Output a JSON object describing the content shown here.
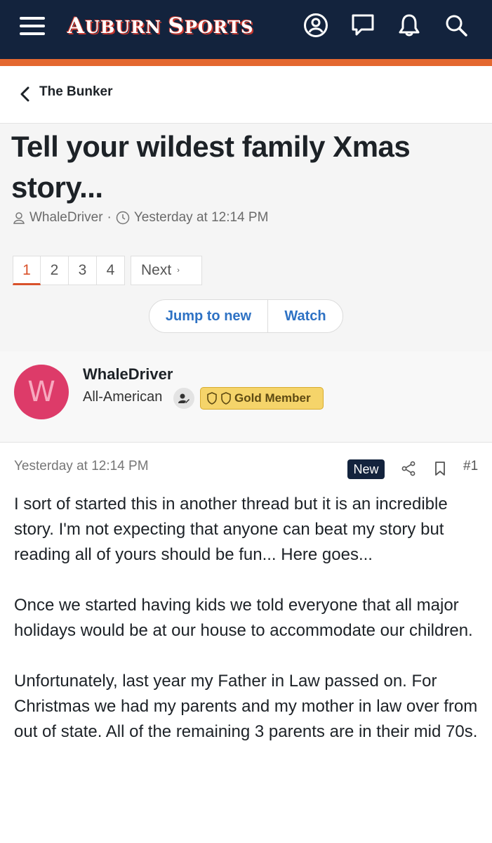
{
  "header": {
    "logo_text_a": "A",
    "logo_text_b": "UBURN ",
    "logo_text_c": "S",
    "logo_text_d": "PORTS",
    "brand_colors": {
      "navy": "#13233d",
      "orange": "#e46830"
    },
    "icons": [
      "menu-icon",
      "account-icon",
      "conversations-icon",
      "alerts-icon",
      "search-icon"
    ]
  },
  "breadcrumb": {
    "label": "The Bunker"
  },
  "thread": {
    "title": "Tell your wildest family Xmas story...",
    "author": "WhaleDriver",
    "separator": "·",
    "date": "Yesterday at 12:14 PM"
  },
  "pagination": {
    "pages": [
      "1",
      "2",
      "3",
      "4"
    ],
    "current": "1",
    "next_label": "Next",
    "next_arrow": "›"
  },
  "actions": {
    "jump_label": "Jump to new",
    "watch_label": "Watch"
  },
  "poster": {
    "avatar_letter": "W",
    "avatar_color": "#dd3b69",
    "name": "WhaleDriver",
    "title": "All-American",
    "badge": "Gold Member"
  },
  "post": {
    "date": "Yesterday at 12:14 PM",
    "new_badge": "New",
    "number": "#1",
    "paragraphs": [
      "I sort of started this in another thread but it is an incredible story. I'm not expecting that anyone can beat my story but reading all of yours should be fun... Here goes...",
      "Once we started having kids we told everyone that all major holidays would be at our house to accommodate our children.",
      "Unfortunately, last year my Father in Law passed on. For Christmas we had my parents and my mother in law over from out of state. All of the remaining 3 parents are in their mid 70s."
    ]
  }
}
